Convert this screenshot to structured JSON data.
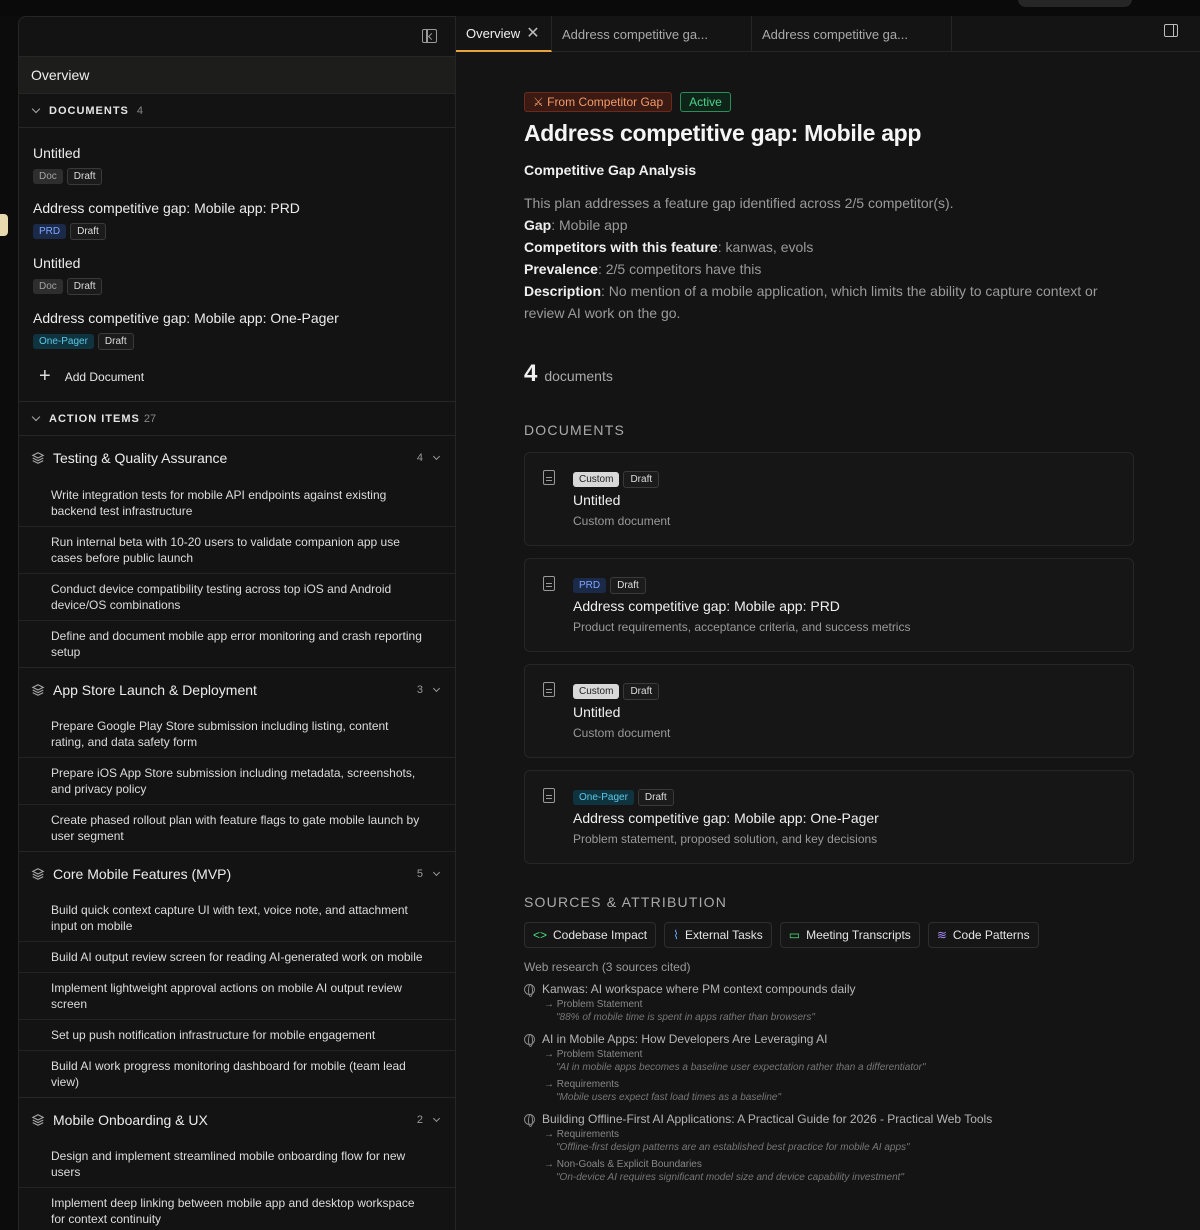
{
  "sidebar": {
    "overview_label": "Overview",
    "documents_header": "DOCUMENTS",
    "documents_count": "4",
    "documents": [
      {
        "title": "Untitled",
        "type": "Doc",
        "status": "Draft"
      },
      {
        "title": "Address competitive gap: Mobile app: PRD",
        "type": "PRD",
        "status": "Draft"
      },
      {
        "title": "Untitled",
        "type": "Doc",
        "status": "Draft"
      },
      {
        "title": "Address competitive gap: Mobile app: One-Pager",
        "type": "One-Pager",
        "status": "Draft"
      }
    ],
    "add_document_label": "Add Document",
    "action_items_header": "ACTION ITEMS",
    "action_items_count": "27",
    "groups": [
      {
        "title": "Testing & Quality Assurance",
        "count": "4",
        "tasks": [
          "Write integration tests for mobile API endpoints against existing backend test infrastructure",
          "Run internal beta with 10-20 users to validate companion app use cases before public launch",
          "Conduct device compatibility testing across top iOS and Android device/OS combinations",
          "Define and document mobile app error monitoring and crash reporting setup"
        ]
      },
      {
        "title": "App Store Launch & Deployment",
        "count": "3",
        "tasks": [
          "Prepare Google Play Store submission including listing, content rating, and data safety form",
          "Prepare iOS App Store submission including metadata, screenshots, and privacy policy",
          "Create phased rollout plan with feature flags to gate mobile launch by user segment"
        ]
      },
      {
        "title": "Core Mobile Features (MVP)",
        "count": "5",
        "tasks": [
          "Build quick context capture UI with text, voice note, and attachment input on mobile",
          "Build AI output review screen for reading AI-generated work on mobile",
          "Implement lightweight approval actions on mobile AI output review screen",
          "Set up push notification infrastructure for mobile engagement",
          "Build AI work progress monitoring dashboard for mobile (team lead view)"
        ]
      },
      {
        "title": "Mobile Onboarding & UX",
        "count": "2",
        "tasks": [
          "Design and implement streamlined mobile onboarding flow for new users",
          "Implement deep linking between mobile app and desktop workspace for context continuity"
        ]
      }
    ]
  },
  "tabs": [
    {
      "label": "Overview"
    },
    {
      "label": "Address competitive ga..."
    },
    {
      "label": "Address competitive ga..."
    }
  ],
  "main": {
    "badge_source": "From Competitor Gap",
    "badge_status": "Active",
    "title": "Address competitive gap: Mobile app",
    "subtitle": "Competitive Gap Analysis",
    "intro": "This plan addresses a feature gap identified across 2/5 competitor(s).",
    "gap_label": "Gap",
    "gap_value": ": Mobile app",
    "competitors_label": "Competitors with this feature",
    "competitors_value": ": kanwas, evols",
    "prevalence_label": "Prevalence",
    "prevalence_value": ": 2/5 competitors have this",
    "description_label": "Description",
    "description_value": ": No mention of a mobile application, which limits the ability to capture context or review AI work on the go.",
    "doc_count": "4",
    "doc_count_label": "documents",
    "documents_title": "DOCUMENTS",
    "cards": [
      {
        "type": "Custom",
        "status": "Draft",
        "title": "Untitled",
        "subtitle": "Custom document"
      },
      {
        "type": "PRD",
        "status": "Draft",
        "title": "Address competitive gap: Mobile app: PRD",
        "subtitle": "Product requirements, acceptance criteria, and success metrics"
      },
      {
        "type": "Custom",
        "status": "Draft",
        "title": "Untitled",
        "subtitle": "Custom document"
      },
      {
        "type": "One-Pager",
        "status": "Draft",
        "title": "Address competitive gap: Mobile app: One-Pager",
        "subtitle": "Problem statement, proposed solution, and key decisions"
      }
    ],
    "sources_title": "SOURCES & ATTRIBUTION",
    "source_buttons": [
      "Codebase Impact",
      "External Tasks",
      "Meeting Transcripts",
      "Code Patterns"
    ],
    "web_research_label": "Web research (3 sources cited)",
    "sources": [
      {
        "title": "Kanwas: AI workspace where PM context compounds daily",
        "refs": [
          {
            "section": "Problem Statement",
            "quote": "\"88% of mobile time is spent in apps rather than browsers\""
          }
        ]
      },
      {
        "title": "AI in Mobile Apps: How Developers Are Leveraging AI",
        "refs": [
          {
            "section": "Problem Statement",
            "quote": "\"AI in mobile apps becomes a baseline user expectation rather than a differentiator\""
          },
          {
            "section": "Requirements",
            "quote": "\"Mobile users expect fast load times as a baseline\""
          }
        ]
      },
      {
        "title": "Building Offline-First AI Applications: A Practical Guide for 2026 - Practical Web Tools",
        "refs": [
          {
            "section": "Requirements",
            "quote": "\"Offline-first design patterns are an established best practice for mobile AI apps\""
          },
          {
            "section": "Non-Goals & Explicit Boundaries",
            "quote": "\"On-device AI requires significant model size and device capability investment\""
          }
        ]
      }
    ]
  }
}
